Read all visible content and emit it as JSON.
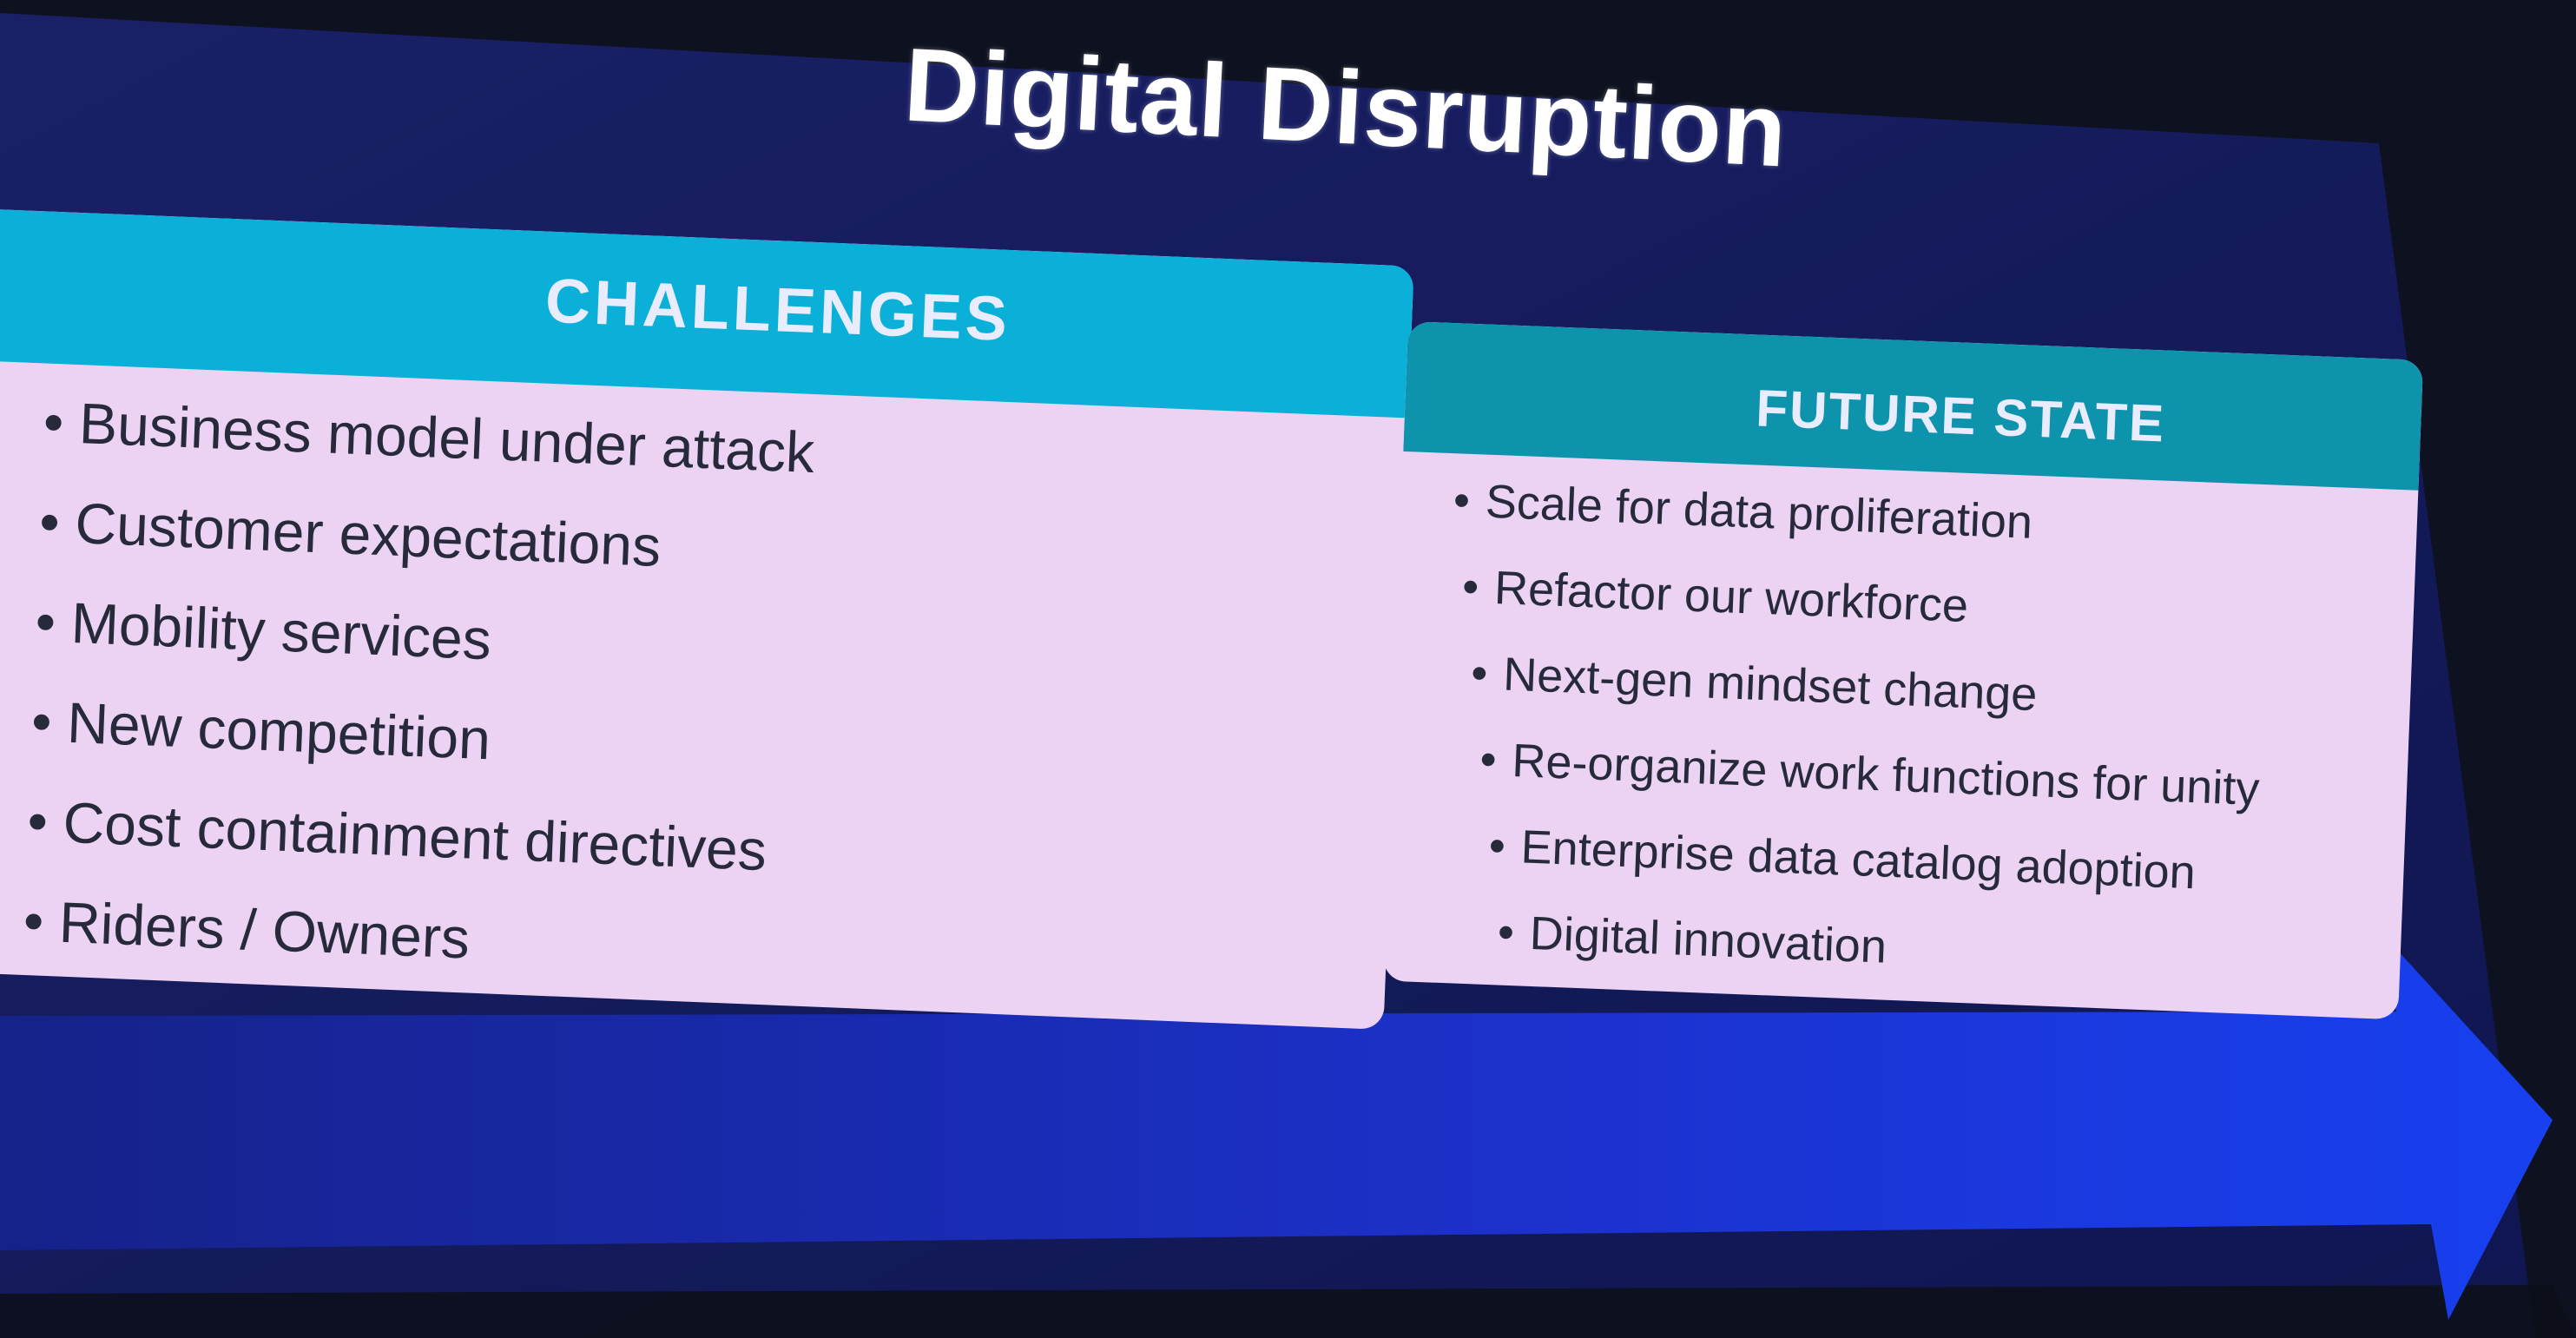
{
  "slide": {
    "title": "Digital Disruption",
    "colors": {
      "slide_background": "#131a55",
      "challenges_header": "#0bb0d8",
      "future_header": "#0e93ac",
      "panel_fill": "#ecd3f4",
      "arrow": "#1a34e6"
    }
  },
  "challenges": {
    "heading": "CHALLENGES",
    "items": [
      "Business model under attack",
      "Customer expectations",
      "Mobility services",
      "New competition",
      "Cost containment directives",
      "Riders / Owners"
    ]
  },
  "future_state": {
    "heading": "FUTURE STATE",
    "items": [
      "Scale for data proliferation",
      "Refactor our workforce",
      "Next-gen mindset change",
      "Re-organize work functions for unity",
      "Enterprise data catalog adoption",
      "Digital innovation"
    ]
  },
  "arrow_icon": "right-arrow-icon"
}
